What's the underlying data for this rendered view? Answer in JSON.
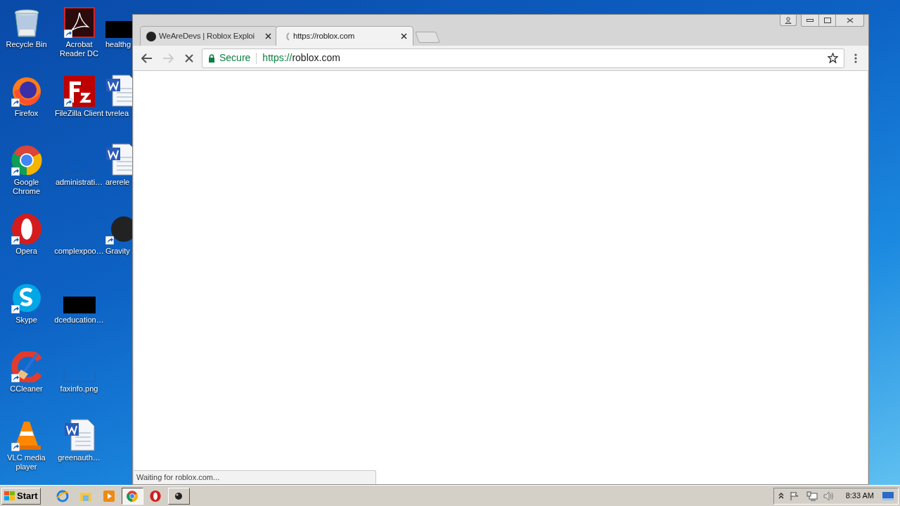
{
  "desktop_icons": [
    {
      "label": "Recycle Bin",
      "kind": "recycle",
      "shortcut": false
    },
    {
      "label": "Firefox",
      "kind": "firefox",
      "shortcut": true
    },
    {
      "label": "Google Chrome",
      "kind": "chrome",
      "shortcut": true
    },
    {
      "label": "Opera",
      "kind": "opera",
      "shortcut": true
    },
    {
      "label": "Skype",
      "kind": "skype",
      "shortcut": true
    },
    {
      "label": "CCleaner",
      "kind": "ccleaner",
      "shortcut": true
    },
    {
      "label": "VLC media player",
      "kind": "vlc",
      "shortcut": true
    },
    {
      "label": "Acrobat Reader DC",
      "kind": "acrobat",
      "shortcut": true
    },
    {
      "label": "FileZilla Client",
      "kind": "filezilla",
      "shortcut": true
    },
    {
      "label": "administrati…",
      "kind": "blank",
      "shortcut": false
    },
    {
      "label": "complexpoo…",
      "kind": "blank",
      "shortcut": false
    },
    {
      "label": "dceducation…",
      "kind": "black",
      "shortcut": false
    },
    {
      "label": "faxinfo.png",
      "kind": "blank",
      "shortcut": false
    },
    {
      "label": "greenauth…",
      "kind": "word",
      "shortcut": false
    },
    {
      "label": "healthg",
      "kind": "black",
      "shortcut": false
    },
    {
      "label": "tvrelea",
      "kind": "word",
      "shortcut": false
    },
    {
      "label": "arerele",
      "kind": "word",
      "shortcut": false
    },
    {
      "label": "Gravity",
      "kind": "gravity",
      "shortcut": true
    }
  ],
  "browser": {
    "tabs": [
      {
        "title": "WeAreDevs | Roblox Exploi",
        "selected": false,
        "loading": false
      },
      {
        "title": "https://roblox.com",
        "selected": true,
        "loading": true
      }
    ],
    "loading": true,
    "forward_disabled": true,
    "security": "Secure",
    "url_scheme": "https://",
    "url_host": "roblox.com",
    "status": "Waiting for roblox.com..."
  },
  "taskbar": {
    "start": "Start",
    "items": [
      {
        "kind": "ie",
        "selected": false
      },
      {
        "kind": "explorer",
        "selected": false
      },
      {
        "kind": "media",
        "selected": false
      },
      {
        "kind": "chrome",
        "selected": true
      },
      {
        "kind": "opera",
        "selected": false
      },
      {
        "kind": "app",
        "selected": false
      }
    ],
    "clock": "8:33 AM"
  }
}
